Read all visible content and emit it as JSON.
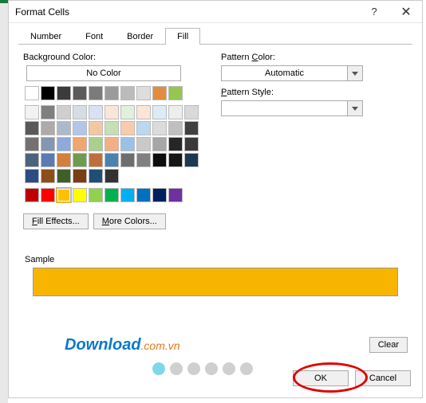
{
  "window": {
    "title": "Format Cells",
    "help": "?",
    "close": "✕"
  },
  "tabs": {
    "number": "Number",
    "font": "Font",
    "border": "Border",
    "fill": "Fill"
  },
  "left": {
    "bg_label": "Background Color:",
    "no_color": "No Color",
    "fill_effects": "ill Effects...",
    "fill_effects_u": "F",
    "more_colors": "ore Colors...",
    "more_colors_u": "M"
  },
  "right": {
    "pattern_color_label": "Pattern Color:",
    "pattern_color_u": "C",
    "pattern_color_pre": "Pattern ",
    "pattern_color_post": "olor:",
    "pattern_color_value": "Automatic",
    "pattern_style_label": "Pattern Style:",
    "pattern_style_u": "P",
    "pattern_style_post": "attern Style:",
    "pattern_style_value": ""
  },
  "sample": {
    "label": "Sample",
    "color": "#f7b500"
  },
  "footer": {
    "clear": "Clear",
    "ok": "OK",
    "cancel": "Cancel"
  },
  "watermark": {
    "dl": "Download",
    "cv": ".com.vn"
  },
  "dots": [
    "#80d7e8",
    "#cfcfcf",
    "#cfcfcf",
    "#cfcfcf",
    "#cfcfcf",
    "#cfcfcf"
  ],
  "palette_top": [
    "#ffffff",
    "#000000",
    "#3b3b3b",
    "#5b5b5b",
    "#7b7b7b",
    "#9b9b9b",
    "#bbbbbb",
    "#dddddd",
    "#e28c42",
    "#96c551"
  ],
  "palette_main": [
    "#f2f2f2",
    "#7f7f7f",
    "#d0cece",
    "#d6dce4",
    "#d9e1f2",
    "#f8e6d8",
    "#e2efda",
    "#fce4d6",
    "#ddebf7",
    "#ededed",
    "#d9d9d9",
    "#595959",
    "#aeaaaa",
    "#acb9ca",
    "#b4c6e7",
    "#f4c7a3",
    "#c6e0b4",
    "#f8cbad",
    "#bdd7ee",
    "#dbdbdb",
    "#bfbfbf",
    "#404040",
    "#757171",
    "#8497b0",
    "#8ea9db",
    "#efa66f",
    "#a9d08e",
    "#f4b084",
    "#9bc2e6",
    "#c9c9c9",
    "#a6a6a6",
    "#262626",
    "#3a3838",
    "#4b637d",
    "#5b7bb4",
    "#d47f3b",
    "#6e9c4e",
    "#bf6f3b",
    "#4a82b0",
    "#6e6e6e",
    "#808080",
    "#0d0d0d",
    "#161616",
    "#203752",
    "#2e4c84",
    "#8e4e1a",
    "#3e6028",
    "#7a3d14",
    "#1f4e78",
    "#333333"
  ],
  "palette_std": [
    "#c00000",
    "#ff0000",
    "#ffc000",
    "#ffff00",
    "#92d050",
    "#00b050",
    "#00b0f0",
    "#0070c0",
    "#002060",
    "#7030a0"
  ],
  "selected_color": "#ffc000"
}
